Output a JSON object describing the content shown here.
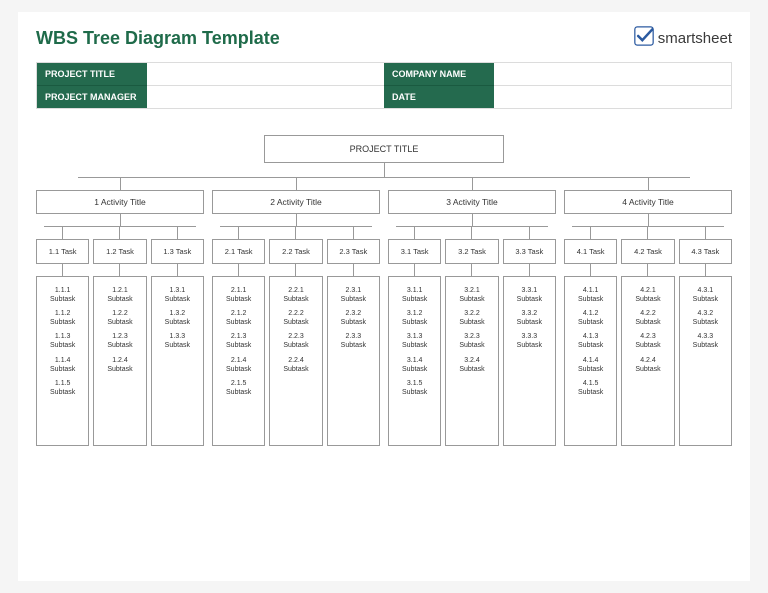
{
  "brand": {
    "name": "smartsheet"
  },
  "title": "WBS Tree Diagram Template",
  "info": {
    "project_title_label": "PROJECT TITLE",
    "company_name_label": "COMPANY NAME",
    "project_manager_label": "PROJECT MANAGER",
    "date_label": "DATE"
  },
  "diagram": {
    "root": "PROJECT TITLE",
    "subtask_label": "Subtask",
    "activities": [
      {
        "label": "1 Activity Title",
        "tasks": [
          {
            "label": "1.1 Task",
            "subs": [
              "1.1.1",
              "1.1.2",
              "1.1.3",
              "1.1.4",
              "1.1.5"
            ]
          },
          {
            "label": "1.2 Task",
            "subs": [
              "1.2.1",
              "1.2.2",
              "1.2.3",
              "1.2.4"
            ]
          },
          {
            "label": "1.3 Task",
            "subs": [
              "1.3.1",
              "1.3.2",
              "1.3.3"
            ]
          }
        ]
      },
      {
        "label": "2 Activity Title",
        "tasks": [
          {
            "label": "2.1 Task",
            "subs": [
              "2.1.1",
              "2.1.2",
              "2.1.3",
              "2.1.4",
              "2.1.5"
            ]
          },
          {
            "label": "2.2 Task",
            "subs": [
              "2.2.1",
              "2.2.2",
              "2.2.3",
              "2.2.4"
            ]
          },
          {
            "label": "2.3 Task",
            "subs": [
              "2.3.1",
              "2.3.2",
              "2.3.3"
            ]
          }
        ]
      },
      {
        "label": "3 Activity Title",
        "tasks": [
          {
            "label": "3.1 Task",
            "subs": [
              "3.1.1",
              "3.1.2",
              "3.1.3",
              "3.1.4",
              "3.1.5"
            ]
          },
          {
            "label": "3.2 Task",
            "subs": [
              "3.2.1",
              "3.2.2",
              "3.2.3",
              "3.2.4"
            ]
          },
          {
            "label": "3.3 Task",
            "subs": [
              "3.3.1",
              "3.3.2",
              "3.3.3"
            ]
          }
        ]
      },
      {
        "label": "4 Activity Title",
        "tasks": [
          {
            "label": "4.1 Task",
            "subs": [
              "4.1.1",
              "4.1.2",
              "4.1.3",
              "4.1.4",
              "4.1.5"
            ]
          },
          {
            "label": "4.2 Task",
            "subs": [
              "4.2.1",
              "4.2.2",
              "4.2.3",
              "4.2.4"
            ]
          },
          {
            "label": "4.3 Task",
            "subs": [
              "4.3.1",
              "4.3.2",
              "4.3.3"
            ]
          }
        ]
      }
    ]
  }
}
